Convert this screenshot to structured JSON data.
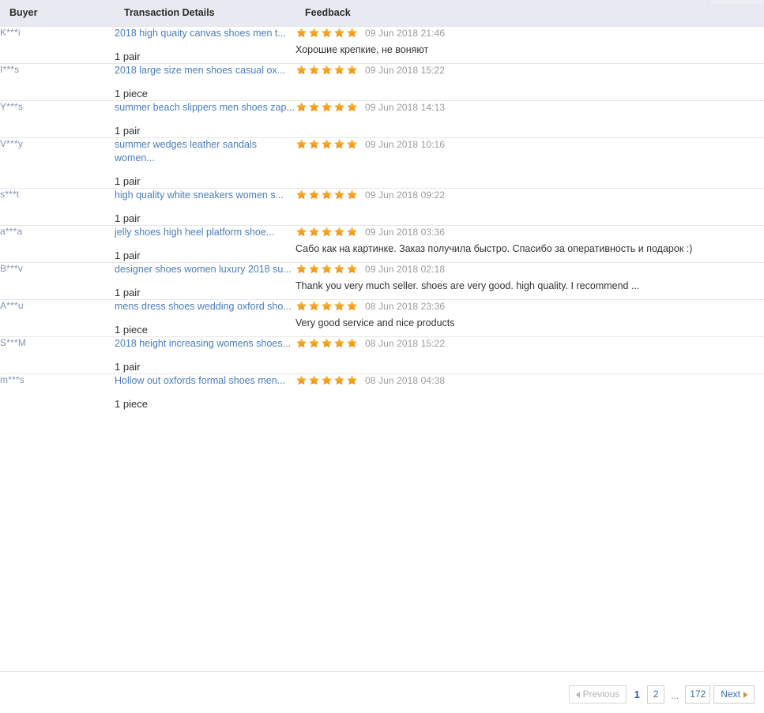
{
  "table": {
    "columns": [
      {
        "key": "buyer",
        "label": "Buyer"
      },
      {
        "key": "transaction",
        "label": "Transaction Details"
      },
      {
        "key": "feedback",
        "label": "Feedback"
      }
    ],
    "rows": [
      {
        "buyer": "K***i",
        "product": "2018 high quaity canvas shoes men t...",
        "quantity": "1 pair",
        "rating": 5,
        "date": "09 Jun 2018 21:46",
        "comment": "Хорошие крепкие, не воняют"
      },
      {
        "buyer": "I***s",
        "product": "2018 large size men shoes casual ox...",
        "quantity": "1 piece",
        "rating": 5,
        "date": "09 Jun 2018 15:22",
        "comment": ""
      },
      {
        "buyer": "Y***s",
        "product": "summer beach slippers men shoes zap...",
        "quantity": "1 pair",
        "rating": 5,
        "date": "09 Jun 2018 14:13",
        "comment": ""
      },
      {
        "buyer": "V***y",
        "product": "summer wedges leather sandals women...",
        "quantity": "1 pair",
        "rating": 5,
        "date": "09 Jun 2018 10:16",
        "comment": ""
      },
      {
        "buyer": "s***t",
        "product": "high quality white sneakers women s...",
        "quantity": "1 pair",
        "rating": 5,
        "date": "09 Jun 2018 09:22",
        "comment": ""
      },
      {
        "buyer": "a***a",
        "product": "jelly shoes high heel platform shoe...",
        "quantity": "1 pair",
        "rating": 5,
        "date": "09 Jun 2018 03:36",
        "comment": "Сабо как на картинке. Заказ получила быстро. Спасибо за оперативность и подарок :)"
      },
      {
        "buyer": "B***v",
        "product": "designer shoes women luxury 2018 su...",
        "quantity": "1 pair",
        "rating": 5,
        "date": "09 Jun 2018 02:18",
        "comment": "Thank you very much seller. shoes are very good. high quality. I recommend ..."
      },
      {
        "buyer": "A***u",
        "product": "mens dress shoes wedding oxford sho...",
        "quantity": "1 piece",
        "rating": 5,
        "date": "08 Jun 2018 23:36",
        "comment": "Very good service and nice products"
      },
      {
        "buyer": "S***M",
        "product": "2018 height increasing womens shoes...",
        "quantity": "1 pair",
        "rating": 5,
        "date": "08 Jun 2018 15:22",
        "comment": ""
      },
      {
        "buyer": "m***s",
        "product": "Hollow out oxfords formal shoes men...",
        "quantity": "1 piece",
        "rating": 5,
        "date": "08 Jun 2018 04:38",
        "comment": ""
      }
    ]
  },
  "pagination": {
    "previous_label": "Previous",
    "next_label": "Next",
    "current_page": "1",
    "pages": [
      "2"
    ],
    "ellipsis": "...",
    "last_page": "172",
    "previous_disabled": true
  },
  "colors": {
    "header_bg": "#e8eaf1",
    "link": "#4a7ebb",
    "buyer": "#8193b2",
    "star": "#f5a623",
    "date": "#9b9b9b",
    "row_border": "#e6e6e6",
    "next_arrow": "#f08022"
  }
}
